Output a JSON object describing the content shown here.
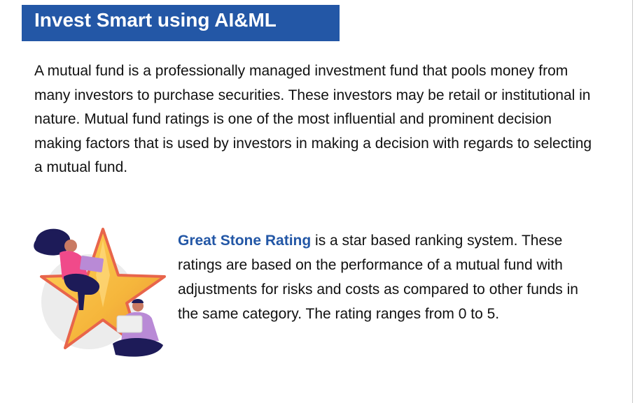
{
  "header": {
    "title": "Invest Smart using AI&ML"
  },
  "intro": {
    "text": "A mutual fund is a professionally managed investment fund that pools money from many investors to purchase securities. These investors may be retail or institutional in nature. Mutual fund ratings is one of the most influential and prominent decision making factors that is used by investors in making a decision with regards to selecting a mutual fund."
  },
  "rating": {
    "name": "Great Stone Rating",
    "description": " is a star based ranking system. These ratings are based on the performance of a mutual fund with adjustments for risks and costs as compared to other funds in the same category. The rating ranges from 0 to 5."
  },
  "colors": {
    "accent": "#2357a6",
    "star_gold": "#f5b63c",
    "star_edge": "#e8654b",
    "figure_pink": "#f04a8a",
    "figure_purple": "#b98ad6",
    "hair_navy": "#1d1b58"
  },
  "icons": {
    "illustration": "star-rating-illustration"
  }
}
